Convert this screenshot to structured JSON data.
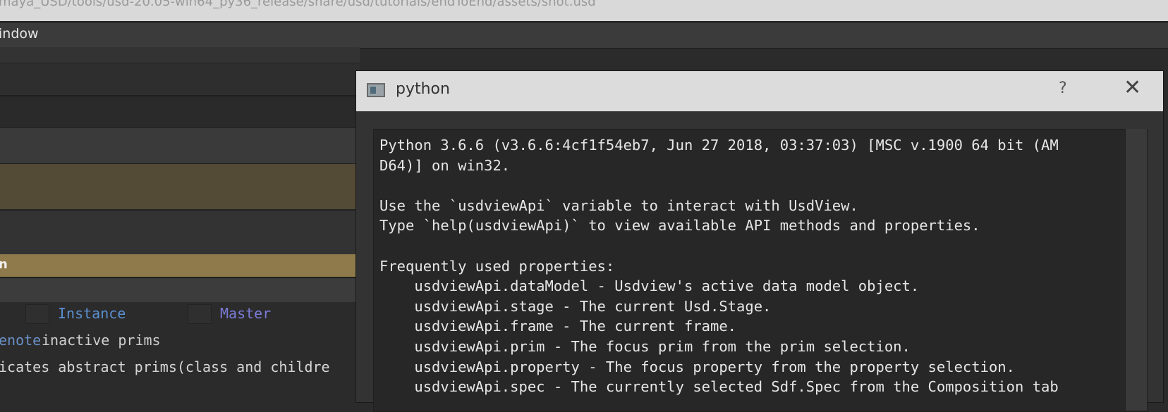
{
  "window": {
    "path": "maya_USD/tools/usd-20.05-win64_py36_release/share/usd/tutorials/endToEnd/assets/shot.usd"
  },
  "menubar": {
    "window_menu": "indow"
  },
  "left_panel": {
    "selected_row_text": "n",
    "legend": {
      "instance_label": "Instance",
      "master_label": "Master",
      "note_prefix": "enote",
      "note_text": " inactive prims",
      "abstract_text": "icates abstract prims(class and childre"
    },
    "colors": {
      "legend_link": "#5b8fd0",
      "inactive": "#7a9ac4",
      "selected_row": "#8f7a4b"
    }
  },
  "dialog": {
    "title": "python",
    "help_label": "?",
    "close_label": "✕",
    "console_lines": [
      "Python 3.6.6 (v3.6.6:4cf1f54eb7, Jun 27 2018, 03:37:03) [MSC v.1900 64 bit (AM",
      "D64)] on win32.",
      "",
      "Use the `usdviewApi` variable to interact with UsdView.",
      "Type `help(usdviewApi)` to view available API methods and properties.",
      "",
      "Frequently used properties:",
      "    usdviewApi.dataModel - Usdview's active data model object.",
      "    usdviewApi.stage - The current Usd.Stage.",
      "    usdviewApi.frame - The current frame.",
      "    usdviewApi.prim - The focus prim from the prim selection.",
      "    usdviewApi.property - The focus property from the property selection.",
      "    usdviewApi.spec - The currently selected Sdf.Spec from the Composition tab"
    ]
  },
  "icons": {
    "dialog": "python-window-icon",
    "help": "help-icon",
    "close": "close-icon"
  }
}
